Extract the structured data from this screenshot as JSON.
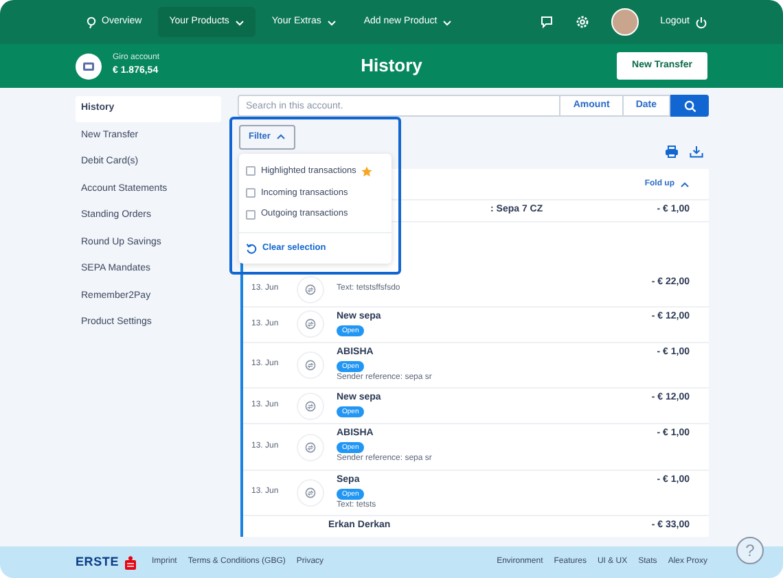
{
  "nav": {
    "items": [
      {
        "label": "Overview",
        "kind": "link",
        "selected": false
      },
      {
        "label": "Your Products",
        "kind": "dropdown",
        "selected": true
      },
      {
        "label": "Your Extras",
        "kind": "dropdown",
        "selected": false
      },
      {
        "label": "Add new Product",
        "kind": "dropdown",
        "selected": false
      }
    ],
    "logout": "Logout"
  },
  "account": {
    "name": "Giro account",
    "balance": "€ 1.876,54"
  },
  "title": "History",
  "new_transfer": "New Transfer",
  "sidebar": {
    "items": [
      {
        "label": "History",
        "selected": true
      },
      {
        "label": "New Transfer",
        "selected": false
      },
      {
        "label": "Debit Card(s)",
        "selected": false
      },
      {
        "label": "Account Statements",
        "selected": false
      },
      {
        "label": "Standing Orders",
        "selected": false
      },
      {
        "label": "Round Up Savings",
        "selected": false
      },
      {
        "label": "SEPA Mandates",
        "selected": false
      },
      {
        "label": "Remember2Pay",
        "selected": false
      },
      {
        "label": "Product Settings",
        "selected": false
      }
    ]
  },
  "search": {
    "placeholder": "Search in this account.",
    "buttons": [
      "Amount",
      "Date"
    ]
  },
  "filter": {
    "label": "Filter",
    "expanded": true,
    "options": [
      {
        "label": "Highlighted transactions",
        "checked": false,
        "starred": true
      },
      {
        "label": "Incoming transactions",
        "checked": false,
        "starred": false
      },
      {
        "label": "Outgoing transactions",
        "checked": false,
        "starred": false
      }
    ],
    "clear": "Clear selection"
  },
  "transactions": {
    "fold": "Fold up",
    "rows": [
      {
        "title": ": Sepa 7 CZ",
        "amount": "- € 1,00"
      },
      {
        "date": "13. Jun",
        "text": "Text: tetstsffsfsdo",
        "amount": "- € 22,00"
      },
      {
        "date": "13. Jun",
        "title": "New sepa",
        "badge": "Open",
        "amount": "- € 12,00"
      },
      {
        "date": "13. Jun",
        "title": "ABISHA",
        "badge": "Open",
        "text": "Sender reference: sepa sr",
        "amount": "- € 1,00"
      },
      {
        "date": "13. Jun",
        "title": "New sepa",
        "badge": "Open",
        "amount": "- € 12,00"
      },
      {
        "date": "13. Jun",
        "title": "ABISHA",
        "badge": "Open",
        "text": "Sender reference: sepa sr",
        "amount": "- € 1,00"
      },
      {
        "date": "13. Jun",
        "title": "Sepa",
        "badge": "Open",
        "text": "Text: tetsts",
        "amount": "- € 1,00"
      },
      {
        "title": "Erkan Derkan",
        "amount": "- € 33,00"
      }
    ]
  },
  "help": "?",
  "footer": {
    "brand": "ERSTE",
    "left_links": [
      "Imprint",
      "Terms & Conditions (GBG)",
      "Privacy"
    ],
    "right_links": [
      "Environment",
      "Features",
      "UI & UX",
      "Stats",
      "Alex Proxy"
    ]
  }
}
